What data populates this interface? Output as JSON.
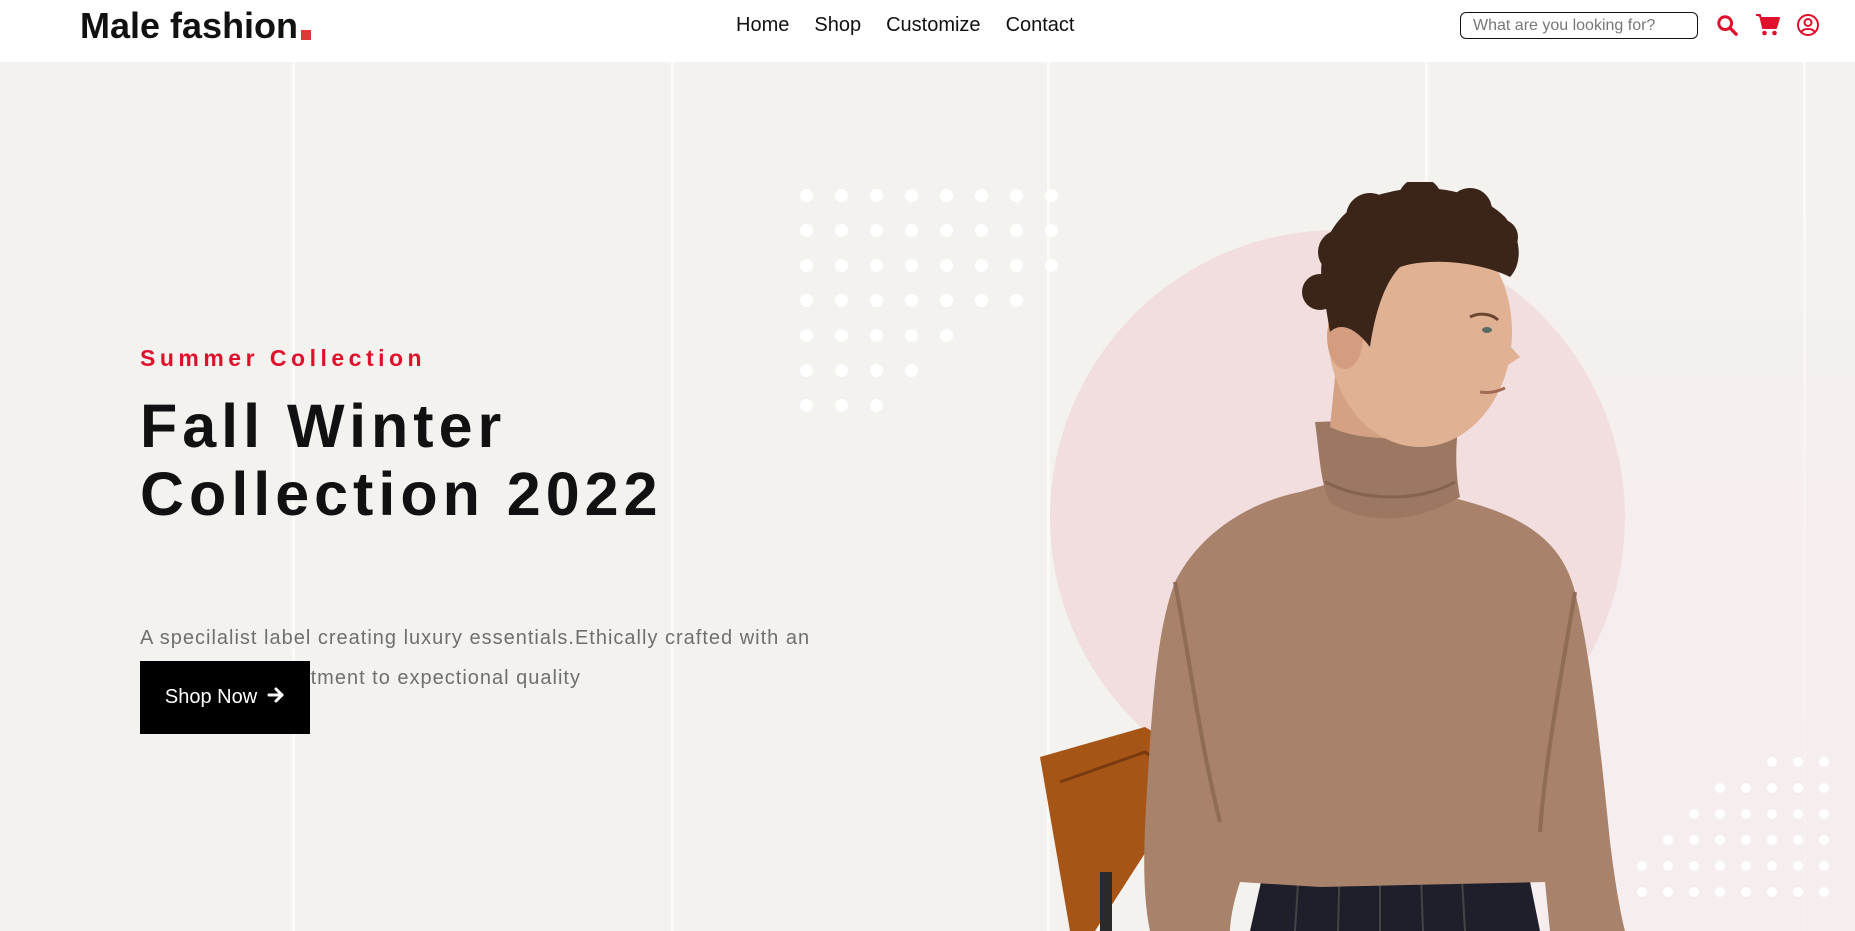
{
  "header": {
    "logo_text": "Male fashion",
    "nav": [
      {
        "label": "Home"
      },
      {
        "label": "Shop"
      },
      {
        "label": "Customize"
      },
      {
        "label": "Contact"
      }
    ],
    "search_placeholder": "What are you looking for?",
    "icons": [
      "search-icon",
      "cart-icon",
      "user-icon"
    ]
  },
  "hero": {
    "subtitle": "Summer Collection",
    "title_line1": "Fall Winter",
    "title_line2": "Collection 2022",
    "description": "A specilalist label creating luxury essentials.Ethically crafted with an unwaverin commitment to expectional quality",
    "button_label": "Shop Now",
    "button_icon": "arrow-right-icon",
    "image": "model-in-turtleneck"
  },
  "colors": {
    "accent": "#e0102d",
    "hero_bg": "#f3f2ee",
    "circle": "#f2dede",
    "button_bg": "#000000"
  }
}
